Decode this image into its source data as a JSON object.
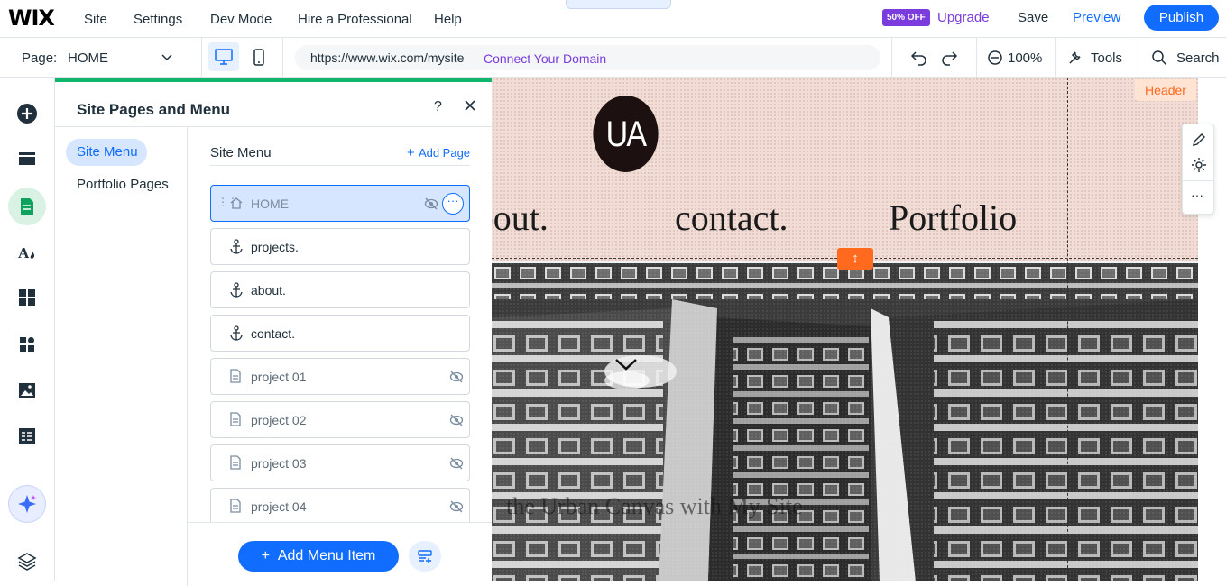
{
  "topbar": {
    "logo": "WIX",
    "menu": [
      "Site",
      "Settings",
      "Dev Mode",
      "Hire a Professional",
      "Help"
    ],
    "badge": "50% OFF",
    "upgrade": "Upgrade",
    "save": "Save",
    "preview": "Preview",
    "publish": "Publish"
  },
  "secondbar": {
    "page_label": "Page:",
    "page_value": "HOME",
    "url": "https://www.wix.com/mysite",
    "connect_domain": "Connect Your Domain",
    "zoom": "100%",
    "tools": "Tools",
    "search": "Search"
  },
  "panel": {
    "title": "Site Pages and Menu",
    "help": "?",
    "nav": [
      "Site Menu",
      "Portfolio Pages"
    ],
    "list_header": "Site Menu",
    "add_page": "Add Page",
    "items": [
      {
        "label": "HOME",
        "icon": "home-icon",
        "selected": true,
        "hidden": true
      },
      {
        "label": "projects.",
        "icon": "anchor-icon",
        "selected": false,
        "hidden": false
      },
      {
        "label": "about.",
        "icon": "anchor-icon",
        "selected": false,
        "hidden": false
      },
      {
        "label": "contact.",
        "icon": "anchor-icon",
        "selected": false,
        "hidden": false
      },
      {
        "label": "project 01",
        "icon": "page-icon",
        "selected": false,
        "hidden": true
      },
      {
        "label": "project 02",
        "icon": "page-icon",
        "selected": false,
        "hidden": true
      },
      {
        "label": "project 03",
        "icon": "page-icon",
        "selected": false,
        "hidden": true
      },
      {
        "label": "project 04",
        "icon": "page-icon",
        "selected": false,
        "hidden": true
      }
    ],
    "add_menu_item": "Add Menu Item"
  },
  "canvas": {
    "logo_text": "UA",
    "nav_words": [
      "about.",
      "contact.",
      "Portfolio"
    ],
    "header_tag": "Header",
    "hero_text": "the Urban Canvas with My Site"
  },
  "colors": {
    "accent": "#116dff",
    "upgrade": "#7a3cdc",
    "panel_accent": "#0fb56a",
    "header_tag": "#ff6a1f"
  }
}
